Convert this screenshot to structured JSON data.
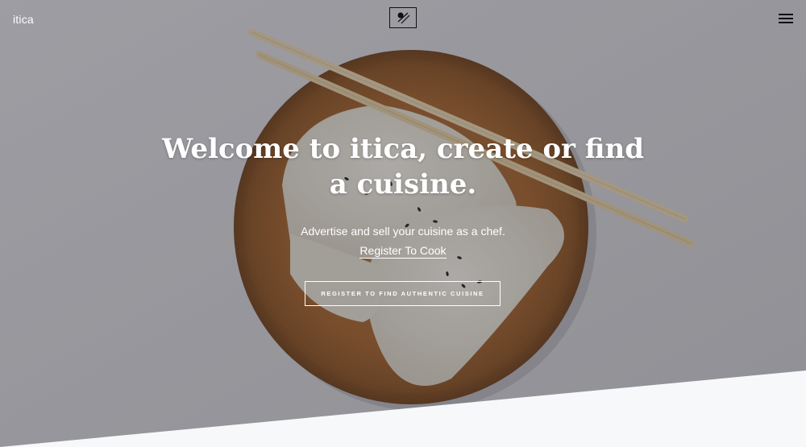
{
  "brand": {
    "name": "itica"
  },
  "logo": {
    "icon": "chopsticks-logo-icon"
  },
  "nav": {
    "menu_icon": "hamburger-menu-icon"
  },
  "hero": {
    "headline": "Welcome to itica, create or find a cuisine.",
    "subtext": "Advertise and sell your cuisine as a chef.",
    "register_cook_link": "Register To Cook",
    "cta_button": "REGISTER TO FIND AUTHENTIC CUISINE"
  },
  "colors": {
    "overlay": "#6b6b6f",
    "text": "#ffffff",
    "band": "#f7f8fa",
    "bowl": "#a5652d"
  }
}
